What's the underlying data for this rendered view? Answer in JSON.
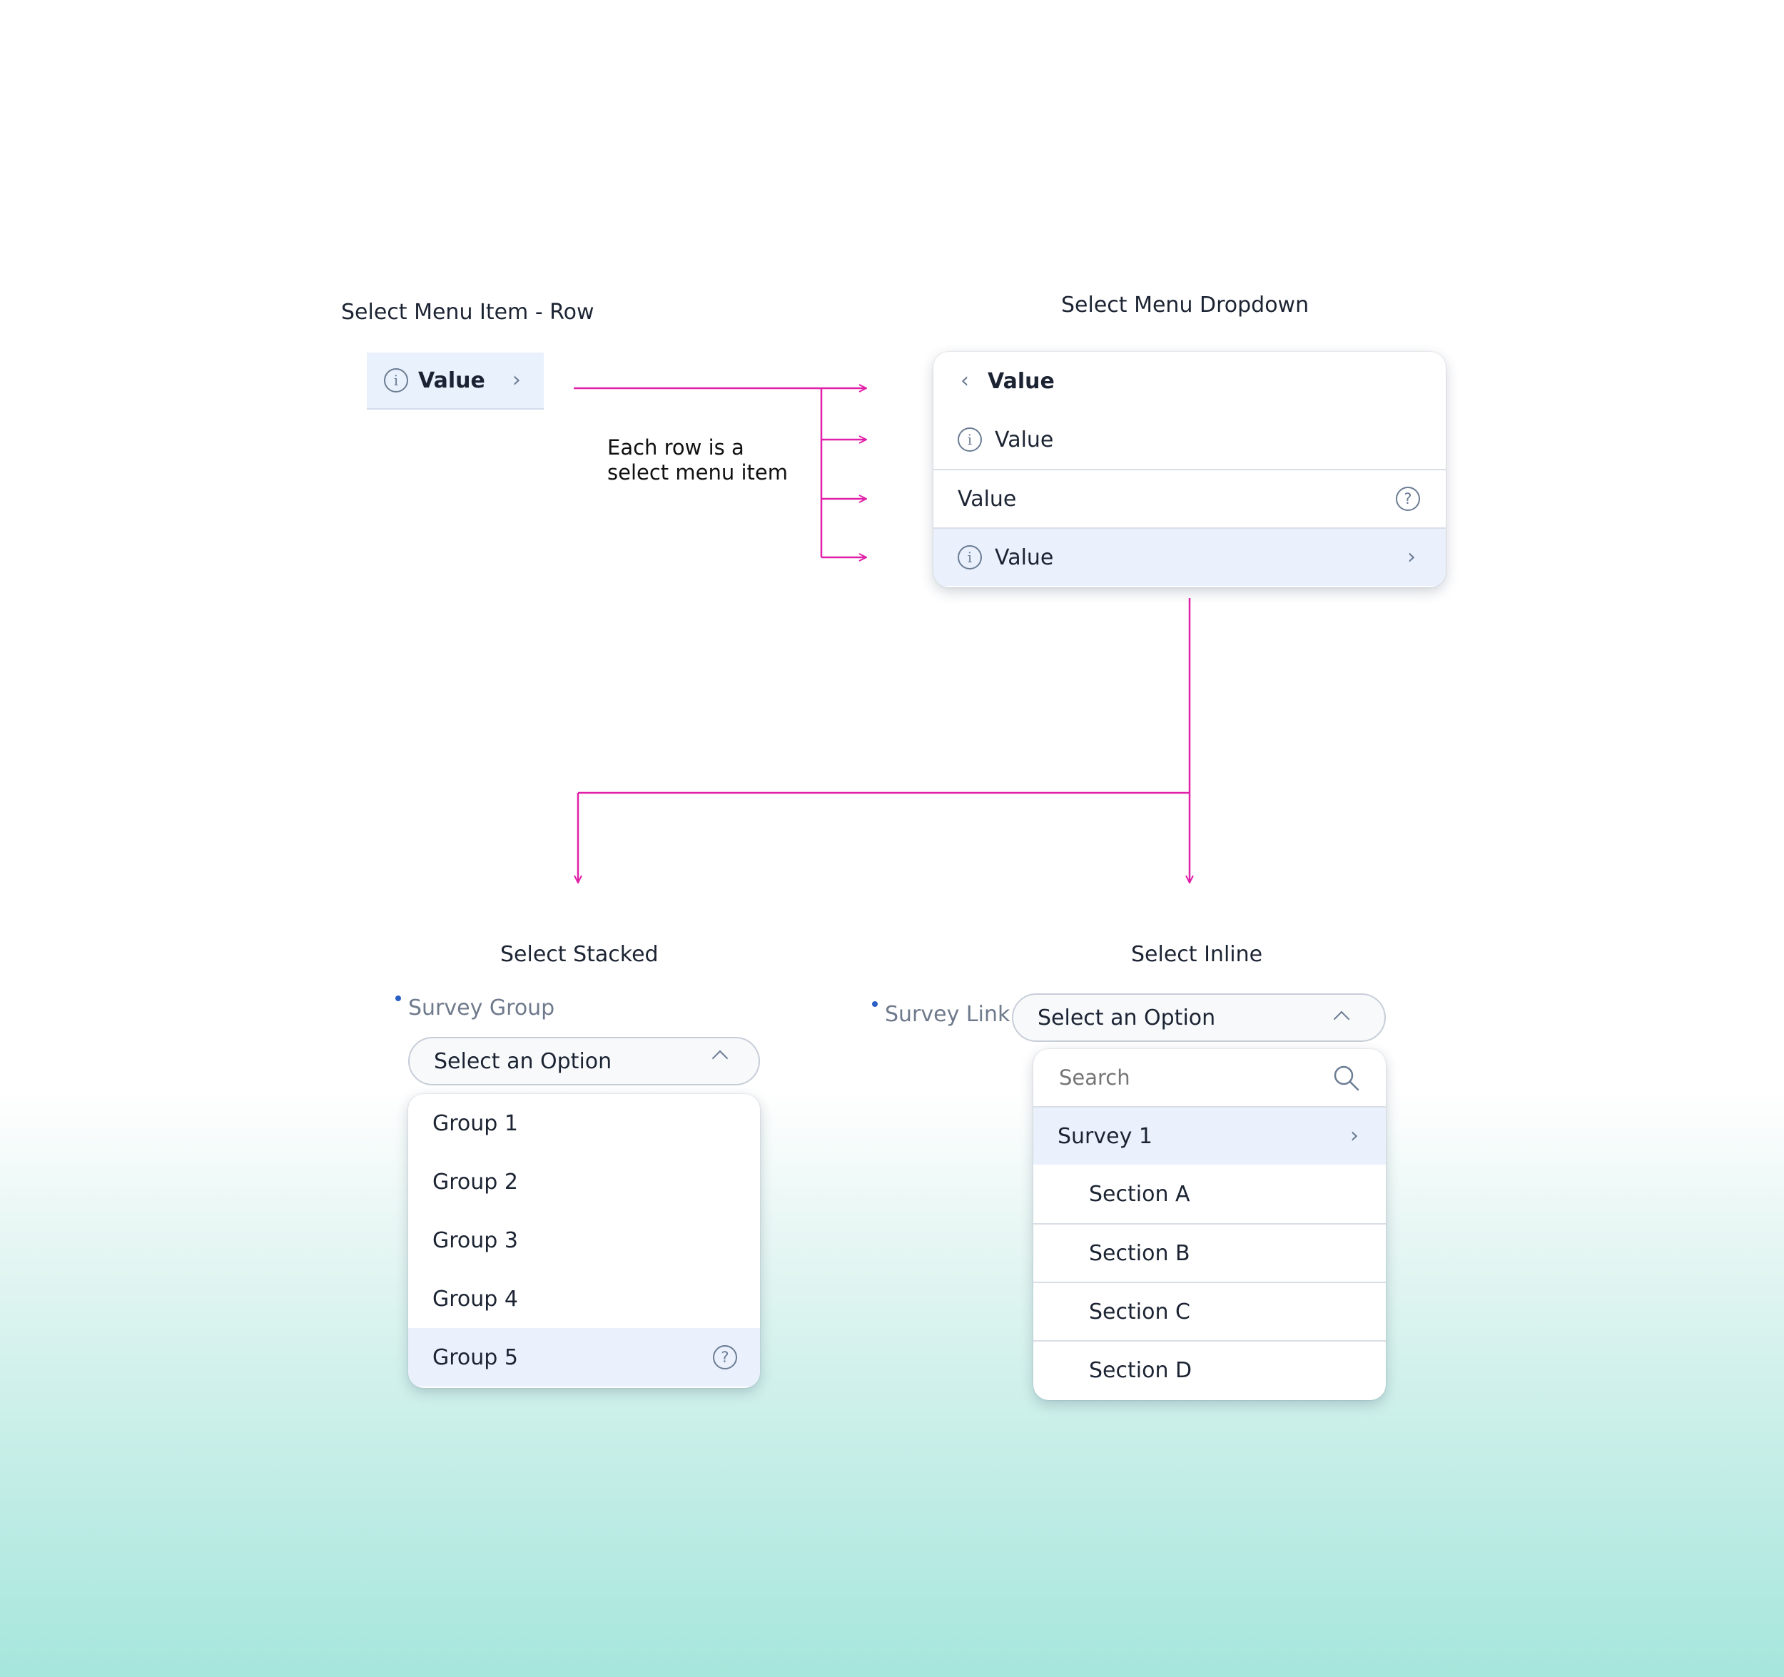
{
  "colors": {
    "connector": "#e020a8",
    "highlight": "#eaf1fd",
    "icon": "#6b7c93",
    "required_dot": "#2a5fc4"
  },
  "row_item": {
    "title": "Select Menu Item - Row",
    "label": "Value",
    "leading_icon": "info-icon",
    "trailing_icon": "chevron-right-icon"
  },
  "annotation": {
    "line1": "Each row is a",
    "line2": "select menu item"
  },
  "dropdown": {
    "title": "Select Menu Dropdown",
    "header_label": "Value",
    "rows": [
      {
        "label": "Value",
        "icon": "info-icon"
      },
      {
        "label": "Value",
        "icon": "help-icon"
      },
      {
        "label": "Value",
        "icon": "info-icon",
        "trailing": "chevron-right-icon",
        "highlighted": true
      }
    ]
  },
  "stacked": {
    "title": "Select Stacked",
    "field_label": "Survey Group",
    "select_value": "Select an Option",
    "options": [
      "Group 1",
      "Group 2",
      "Group 3",
      "Group 4",
      "Group 5"
    ],
    "highlighted_index": 4
  },
  "inline": {
    "title": "Select Inline",
    "field_label": "Survey Link",
    "select_value": "Select an Option",
    "search_placeholder": "Search",
    "parent": "Survey 1",
    "children": [
      "Section A",
      "Section B",
      "Section C",
      "Section D"
    ]
  }
}
